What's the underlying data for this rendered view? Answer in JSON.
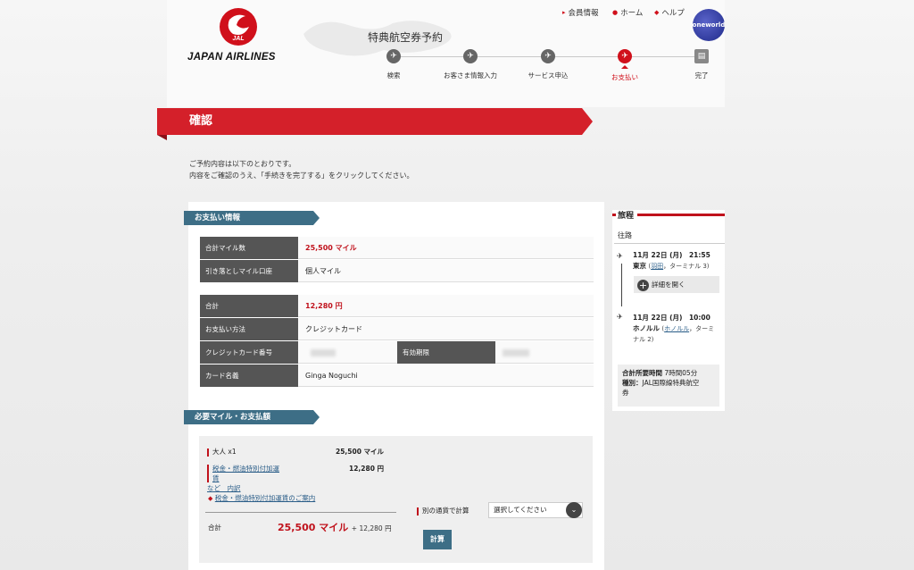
{
  "header": {
    "logo_mark": "JAL",
    "logo_text": "JAPAN AIRLINES",
    "title": "特典航空券予約",
    "nav": [
      {
        "label": "会員情報",
        "icon": "triangle-icon"
      },
      {
        "label": "ホーム",
        "icon": "home-icon"
      },
      {
        "label": "ヘルプ",
        "icon": "help-icon"
      }
    ],
    "alliance_logo": "oneworld"
  },
  "steps": [
    {
      "label": "検索",
      "active": false
    },
    {
      "label": "お客さま情報入力",
      "active": false
    },
    {
      "label": "サービス申込",
      "active": false
    },
    {
      "label": "お支払い",
      "active": true
    },
    {
      "label": "完了",
      "active": false
    }
  ],
  "page": {
    "heading": "確認",
    "intro_line1": "ご予約内容は以下のとおりです。",
    "intro_line2": "内容をご確認のうえ、「手続きを完了する」をクリックしてください。"
  },
  "payment_info": {
    "title": "お支払い情報",
    "total_miles_label": "合計マイル数",
    "total_miles_value": "25,500 マイル",
    "account_label": "引き落としマイル口座",
    "account_value": "個人マイル",
    "total_label": "合計",
    "total_value": "12,280 円",
    "method_label": "お支払い方法",
    "method_value": "クレジットカード",
    "card_number_label": "クレジットカード番号",
    "expiry_label": "有効期限",
    "card_name_label": "カード名義",
    "card_name_value": "Ginga Noguchi"
  },
  "required": {
    "title": "必要マイル・お支払額",
    "adult_label": "大人 x1",
    "adult_miles": "25,500 マイル",
    "tax_link_line1": "税金・燃油特別付加運賃",
    "tax_link_line2": "など　内訳",
    "tax_amount": "12,280 円",
    "tax_info_link": "税金・燃油特別付加運賃のご案内",
    "total_label": "合計",
    "total_miles": "25,500 マイル",
    "total_plus_yen": "+ 12,280 円",
    "currency_label": "別の通貨で計算",
    "currency_placeholder": "選択してください",
    "calc_button": "計算"
  },
  "itinerary": {
    "title": "旅程",
    "route_label": "往路",
    "dep_datetime": "11月 22日 (月)　21:55",
    "dep_city": "東京",
    "dep_airport": "羽田",
    "dep_terminal": "，ターミナル 3)",
    "detail_button": "詳細を開く",
    "arr_datetime": "11月 22日 (月)　10:00",
    "arr_city": "ホノルル",
    "arr_airport": "ホノルル",
    "arr_terminal_a": "，ターミ",
    "arr_terminal_b": "ナル 2)",
    "duration_label": "合計所要時間",
    "duration_value": "7時間05分",
    "type_label": "種別：",
    "type_value": "JAL国際線特典航空",
    "type_value2": "券"
  },
  "colors": {
    "brand_red": "#d4202a",
    "section_blue": "#3d6e86",
    "label_gray": "#555555"
  }
}
